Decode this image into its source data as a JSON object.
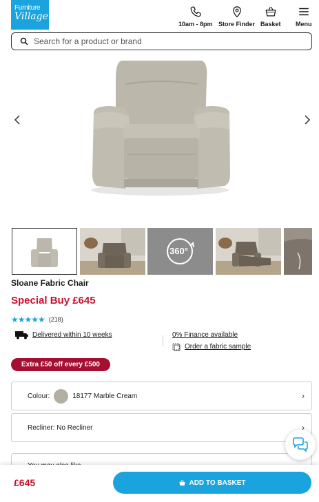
{
  "brand": {
    "line1": "Furniture",
    "line2": "Village"
  },
  "header_nav": [
    {
      "label": "10am - 8pm",
      "icon": "phone-icon"
    },
    {
      "label": "Store Finder",
      "icon": "map-pin-icon"
    },
    {
      "label": "Basket",
      "icon": "basket-icon"
    },
    {
      "label": "Menu",
      "icon": "hamburger-icon"
    }
  ],
  "search": {
    "placeholder": "Search for a product or brand"
  },
  "gallery": {
    "thumb_360_label": "360°",
    "prev_icon": "chevron-left-icon",
    "next_icon": "chevron-right-icon"
  },
  "product": {
    "name": "Sloane Fabric Chair",
    "price_label": "Special Buy £645",
    "rating": 4.5,
    "rating_stars": "★★★★★",
    "review_count": "(218)"
  },
  "info": {
    "delivery": "Delivered within 10 weeks",
    "finance": "0% Finance available",
    "sample": "Order a fabric sample"
  },
  "promo": "Extra £50 off every £500",
  "options": {
    "colour_label": "Colour:",
    "colour_value": "18177 Marble Cream",
    "recliner": "Recliner: No Recliner",
    "partial": "You may also like"
  },
  "bottom_bar": {
    "price": "£645",
    "add_to_basket": "ADD TO BASKET"
  },
  "colors": {
    "brand_blue": "#1aa3dd",
    "price_red": "#c8102e",
    "promo_red": "#a51032",
    "swatch": "#b4afa3"
  }
}
